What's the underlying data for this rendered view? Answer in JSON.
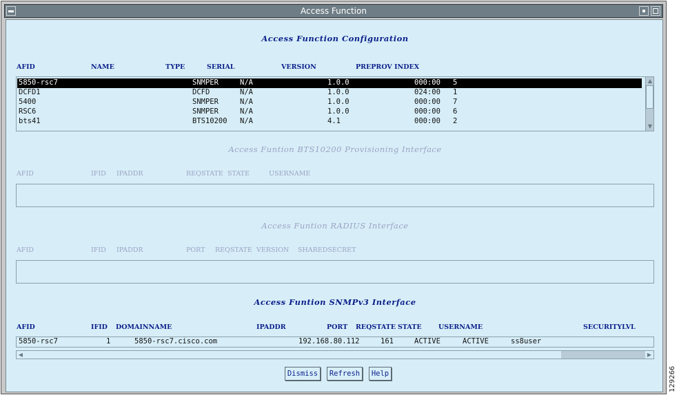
{
  "window": {
    "title": "Access Function"
  },
  "af_config": {
    "title": "Access Function Configuration",
    "headers": [
      "AFID",
      "NAME",
      "TYPE",
      "SERIAL",
      "VERSION",
      "PREPROV INDEX"
    ],
    "rows": [
      {
        "afid": "5850-rsc7",
        "type": "SNMPER",
        "serial": "N/A",
        "version": "1.0.0",
        "preprov": "000:00",
        "index": "5"
      },
      {
        "afid": "DCFD1",
        "type": "DCFD",
        "serial": "N/A",
        "version": "1.0.0",
        "preprov": "024:00",
        "index": "1"
      },
      {
        "afid": "5400",
        "type": "SNMPER",
        "serial": "N/A",
        "version": "1.0.0",
        "preprov": "000:00",
        "index": "7"
      },
      {
        "afid": "RSC6",
        "type": "SNMPER",
        "serial": "N/A",
        "version": "1.0.0",
        "preprov": "000:00",
        "index": "6"
      },
      {
        "afid": "bts41",
        "type": "BTS10200",
        "serial": "N/A",
        "version": "4.1",
        "preprov": "000:00",
        "index": "2"
      }
    ]
  },
  "bts_iface": {
    "title": "Access Funtion BTS10200 Provisioning Interface",
    "headers": [
      "AFID",
      "IFID",
      "IPADDR",
      "REQSTATE",
      "STATE",
      "USERNAME"
    ]
  },
  "radius_iface": {
    "title": "Access Funtion RADIUS Interface",
    "headers": [
      "AFID",
      "IFID",
      "IPADDR",
      "PORT",
      "REQSTATE",
      "VERSION",
      "SHAREDSECRET"
    ]
  },
  "snmp_iface": {
    "title": "Access Funtion SNMPv3 Interface",
    "headers": [
      "AFID",
      "IFID",
      "DOMAINNAME",
      "IPADDR",
      "PORT",
      "REQSTATE",
      "STATE",
      "USERNAME",
      "SECURITYLVL"
    ],
    "rows": [
      {
        "afid": "5850-rsc7",
        "ifid": "1",
        "domain": "5850-rsc7.cisco.com",
        "ipaddr": "192.168.80.112",
        "port": "161",
        "reqstate": "ACTIVE",
        "state": "ACTIVE",
        "username": "ss8user"
      }
    ]
  },
  "buttons": {
    "dismiss": "Dismiss",
    "refresh": "Refresh",
    "help": "Help"
  },
  "side_id": "129266"
}
